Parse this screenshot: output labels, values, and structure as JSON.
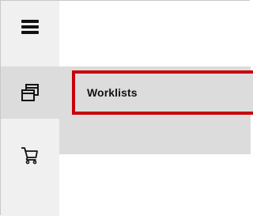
{
  "sidebar": {
    "items": [
      {
        "id": "menu",
        "icon": "hamburger-menu-icon"
      },
      {
        "id": "worklists",
        "icon": "worklists-stack-icon",
        "active": true
      },
      {
        "id": "cart",
        "icon": "shopping-cart-icon"
      }
    ]
  },
  "flyout": {
    "items": [
      {
        "label": "Worklists",
        "highlighted": true
      }
    ]
  },
  "colors": {
    "rail_background": "#f0f0f0",
    "active_background": "#dcdcdc",
    "highlight_border": "#c8000a",
    "icon": "#111111"
  }
}
